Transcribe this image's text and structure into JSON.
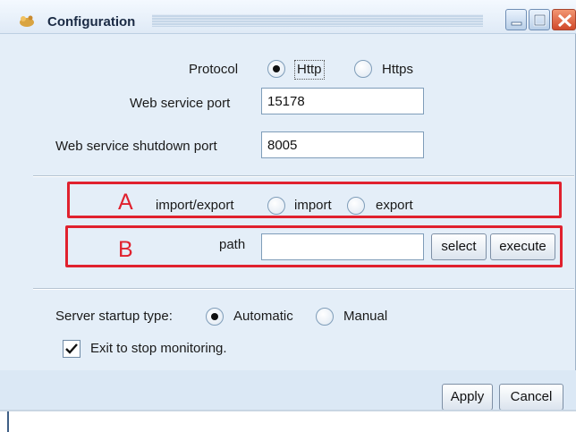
{
  "window": {
    "title": "Configuration"
  },
  "protocol": {
    "label": "Protocol",
    "options": [
      {
        "label": "Http",
        "selected": true
      },
      {
        "label": "Https",
        "selected": false
      }
    ]
  },
  "web_service_port": {
    "label": "Web service port",
    "value": "15178"
  },
  "web_service_shutdown_port": {
    "label": "Web service shutdown port",
    "value": "8005"
  },
  "section_a": {
    "marker": "A",
    "label": "import/export",
    "options": [
      {
        "label": "import",
        "selected": false
      },
      {
        "label": "export",
        "selected": false
      }
    ]
  },
  "section_b": {
    "marker": "B",
    "label": "path",
    "value": "",
    "select_label": "select",
    "execute_label": "execute"
  },
  "startup": {
    "label": "Server startup type:",
    "options": [
      {
        "label": "Automatic",
        "selected": true
      },
      {
        "label": "Manual",
        "selected": false
      }
    ]
  },
  "exit_checkbox": {
    "label": "Exit to stop monitoring.",
    "checked": true
  },
  "footer": {
    "apply_label": "Apply",
    "cancel_label": "Cancel"
  },
  "colors": {
    "highlight_red": "#e0212e",
    "window_bg": "#e4eef8"
  }
}
